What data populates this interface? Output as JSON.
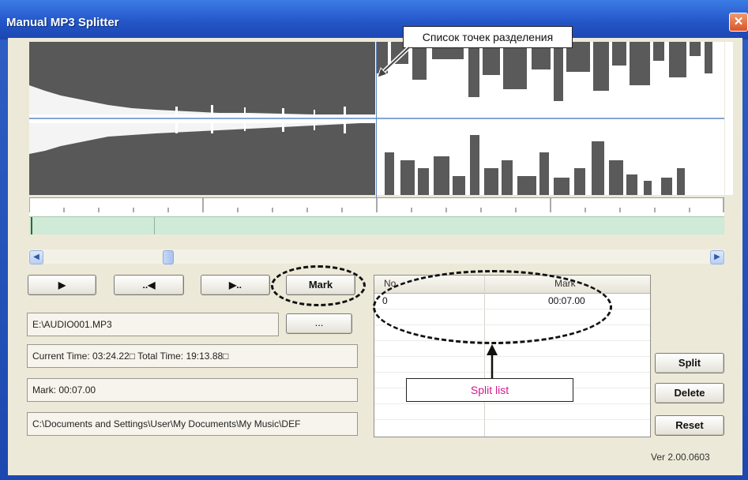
{
  "window": {
    "title": "Manual MP3 Splitter",
    "close_glyph": "✕"
  },
  "transport": {
    "play_glyph": "▶",
    "prev_glyph": "..◀",
    "next_glyph": "▶..",
    "mark_label": "Mark"
  },
  "file": {
    "path": "E:\\AUDIO001.MP3",
    "browse_label": "..."
  },
  "status": {
    "time_text": "Current Time: 03:24.22□ Total Time: 19:13.88□",
    "mark_text": "Mark: 00:07.00",
    "output_path": "C:\\Documents and Settings\\User\\My Documents\\My Music\\DEF"
  },
  "split_list": {
    "columns": [
      "No",
      "Mark"
    ],
    "rows": [
      {
        "no": "0",
        "mark": "00:07.00"
      }
    ]
  },
  "actions": {
    "split_label": "Split",
    "delete_label": "Delete",
    "reset_label": "Reset"
  },
  "version": "Ver 2.00.0603",
  "annotations": {
    "top_callout": "Список точек разделения",
    "split_list_callout": "Split list"
  },
  "scrollbar": {
    "left_glyph": "◀",
    "right_glyph": "▶"
  },
  "colors": {
    "titlebar": "#2456c8",
    "waveform": "#555555",
    "overview": "#cfead6",
    "callout_text_accent": "#d21a8c"
  },
  "icons": [
    "close-icon",
    "play-icon",
    "prev-mark-icon",
    "next-mark-icon",
    "scroll-left-icon",
    "scroll-right-icon",
    "arrow-icon"
  ]
}
